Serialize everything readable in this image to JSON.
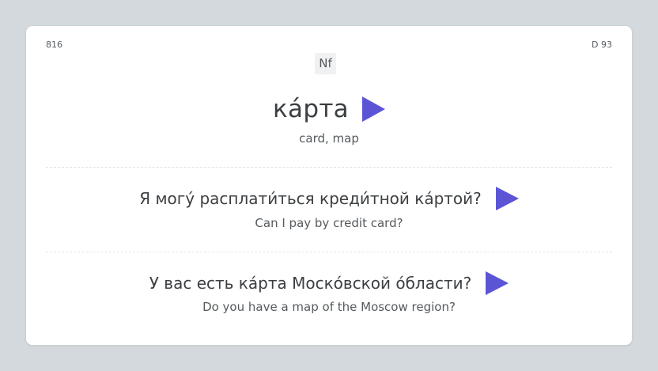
{
  "card": {
    "id_left": "816",
    "id_right": "D 93",
    "part_of_speech": "Nf",
    "headword": "ка́рта",
    "translation": "card, map",
    "play_icon": "play-icon",
    "accent_color": "#5b55d6"
  },
  "examples": [
    {
      "russian": "Я могу́ расплати́ться креди́тной ка́ртой?",
      "english": "Can I pay by credit card?"
    },
    {
      "russian": "У вас есть ка́рта Моско́вской о́бласти?",
      "english": "Do you have a map of the Moscow region?"
    }
  ]
}
